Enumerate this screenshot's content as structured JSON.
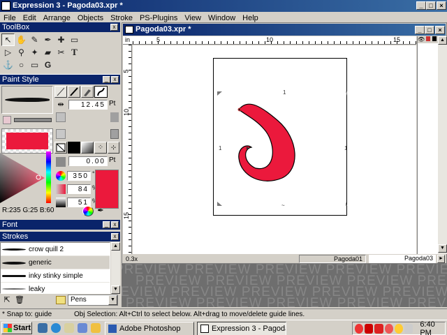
{
  "window": {
    "title": "Expression 3 - Pagoda03.xpr *"
  },
  "menu": [
    "File",
    "Edit",
    "Arrange",
    "Objects",
    "Stroke",
    "PS-Plugins",
    "View",
    "Window",
    "Help"
  ],
  "toolbox": {
    "title": "ToolBox"
  },
  "paint_style": {
    "title": "Paint Style",
    "stroke_width": "12.45",
    "stroke_unit": "Pt",
    "offset": "0.00",
    "offset_unit": "Pt",
    "hue": "350",
    "hue_unit": "°",
    "saturation": "84",
    "sat_unit": "%",
    "brightness": "51",
    "bri_unit": "%",
    "rgb": "R:235 G:25 B:60",
    "fill_color": "#eb193c"
  },
  "font_panel": {
    "title": "Font"
  },
  "strokes_panel": {
    "title": "Strokes",
    "items": [
      "crow quill 2",
      "generic",
      "inky stinky simple",
      "leaky"
    ],
    "category": "Pens"
  },
  "document": {
    "title": "Pagoda03.xpr *",
    "zoom": "0.3x",
    "tabs": [
      "Pagoda01",
      "Pagoda03"
    ],
    "ruler_h": [
      "in",
      "5",
      "10",
      "15"
    ],
    "ruler_v": [
      "5",
      "10",
      "15"
    ],
    "preview_word": "PREVIEW"
  },
  "status": {
    "snap": "* Snap to: guide",
    "hint": "Obj Selection: Alt+Ctrl to select below. Alt+drag to move/delete guide lines."
  },
  "taskbar": {
    "start": "Start",
    "tasks": [
      "Adobe Photoshop",
      "Expression 3 - Pagoda..."
    ],
    "clock": "6:40 PM"
  }
}
